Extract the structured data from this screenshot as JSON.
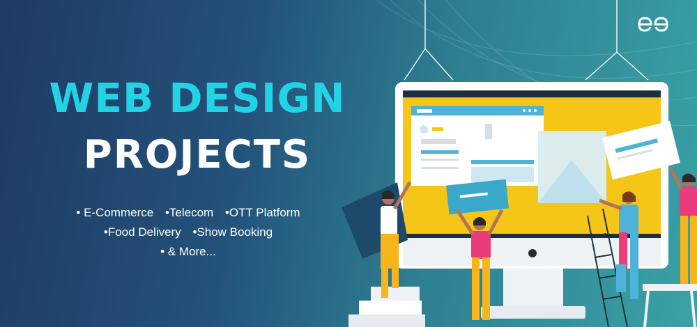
{
  "banner": {
    "title_line1": "WEB DESIGN",
    "title_line2": "PROJECTS",
    "bullets_row1": [
      "• E-Commerce",
      "•Telecom",
      "•OTT Platform"
    ],
    "bullets_row2": [
      "•Food Delivery",
      "•Show Booking"
    ],
    "bullets_row3": [
      "• & More..."
    ],
    "logo_icon": "gfg-logo-icon",
    "colors": {
      "title_accent": "#22d3e6",
      "title_white": "#ffffff",
      "bg_start": "#1f3a63",
      "bg_end": "#3aa2a6",
      "screen_yellow": "#f5c518",
      "figure_pink": "#ec3b7a"
    }
  }
}
